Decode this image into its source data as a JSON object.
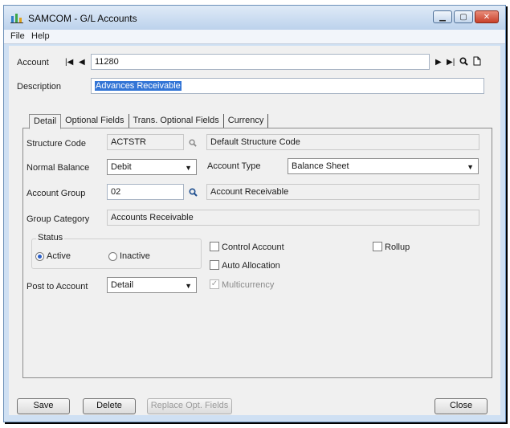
{
  "window": {
    "title": "SAMCOM - G/L Accounts"
  },
  "menu": {
    "file": "File",
    "help": "Help"
  },
  "account": {
    "label": "Account",
    "value": "11280"
  },
  "description": {
    "label": "Description",
    "value": "Advances Receivable"
  },
  "tabs": [
    {
      "label": "Detail",
      "active": true
    },
    {
      "label": "Optional Fields",
      "active": false
    },
    {
      "label": "Trans. Optional Fields",
      "active": false
    },
    {
      "label": "Currency",
      "active": false
    }
  ],
  "detail": {
    "structure_code": {
      "label": "Structure Code",
      "value": "ACTSTR",
      "description": "Default Structure Code"
    },
    "normal_balance": {
      "label": "Normal Balance",
      "value": "Debit"
    },
    "account_type": {
      "label": "Account Type",
      "value": "Balance Sheet"
    },
    "account_group": {
      "label": "Account Group",
      "value": "02",
      "description": "Account Receivable"
    },
    "group_category": {
      "label": "Group Category",
      "value": "Accounts Receivable"
    },
    "status": {
      "label": "Status",
      "active_label": "Active",
      "inactive_label": "Inactive",
      "selected": "Active"
    },
    "control_account": {
      "label": "Control Account",
      "checked": false
    },
    "auto_allocation": {
      "label": "Auto Allocation",
      "checked": false
    },
    "multicurrency": {
      "label": "Multicurrency",
      "checked": true,
      "disabled": true
    },
    "rollup": {
      "label": "Rollup",
      "checked": false
    },
    "post_to_account": {
      "label": "Post to Account",
      "value": "Detail"
    }
  },
  "buttons": {
    "save": "Save",
    "delete": "Delete",
    "replace_opt_fields": "Replace Opt. Fields",
    "close": "Close"
  },
  "colors": {
    "title_gradient": "#bcd2ec",
    "close_button": "#c8402a",
    "selection": "#3375d6"
  }
}
